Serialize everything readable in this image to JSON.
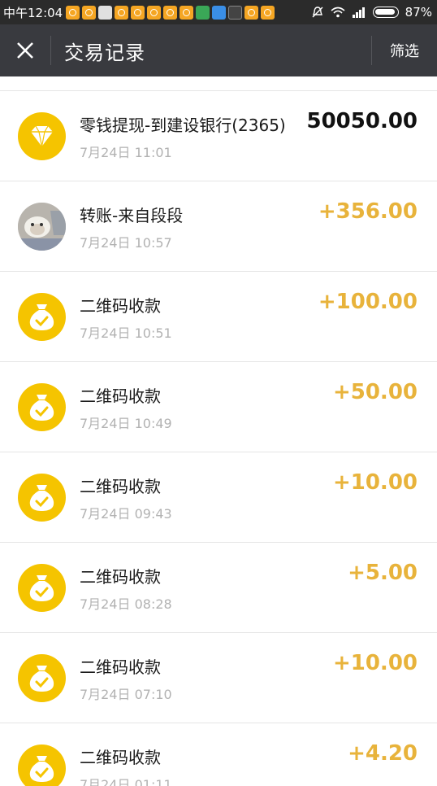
{
  "status_bar": {
    "time": "中午12:04",
    "battery": "87%"
  },
  "nav": {
    "title": "交易记录",
    "filter": "筛选"
  },
  "transactions": [
    {
      "title": "零钱提现-到建设银行(2365)",
      "time": "7月24日 11:01",
      "amount": "50050.00",
      "icon": "diamond-icon"
    },
    {
      "title": "转账-来自段段",
      "time": "7月24日 10:57",
      "amount": "+356.00",
      "icon": "avatar"
    },
    {
      "title": "二维码收款",
      "time": "7月24日 10:51",
      "amount": "+100.00",
      "icon": "money-bag-icon"
    },
    {
      "title": "二维码收款",
      "time": "7月24日 10:49",
      "amount": "+50.00",
      "icon": "money-bag-icon"
    },
    {
      "title": "二维码收款",
      "time": "7月24日 09:43",
      "amount": "+10.00",
      "icon": "money-bag-icon"
    },
    {
      "title": "二维码收款",
      "time": "7月24日 08:28",
      "amount": "+5.00",
      "icon": "money-bag-icon"
    },
    {
      "title": "二维码收款",
      "time": "7月24日 07:10",
      "amount": "+10.00",
      "icon": "money-bag-icon"
    },
    {
      "title": "二维码收款",
      "time": "7月24日 01:11",
      "amount": "+4.20",
      "icon": "money-bag-icon"
    }
  ],
  "colors": {
    "income": "#e8b33b",
    "icon_bg": "#f5c400",
    "nav_bg": "#393a3f"
  }
}
